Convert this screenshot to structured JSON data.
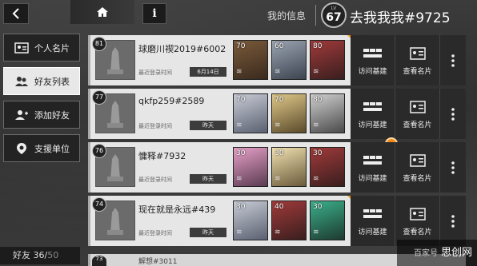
{
  "topbar": {
    "back_icon": "back-arrow-icon",
    "home_icon": "home-icon",
    "info_label": "i",
    "my_info_label": "我的信息",
    "level_small": "LV",
    "level": "67",
    "my_name": "去我我我#9725"
  },
  "menu": [
    {
      "label": "个人名片",
      "icon": "id-card-icon",
      "active": false
    },
    {
      "label": "好友列表",
      "icon": "friends-icon",
      "active": true
    },
    {
      "label": "添加好友",
      "icon": "add-friend-icon",
      "active": false
    },
    {
      "label": "支援单位",
      "icon": "support-unit-icon",
      "active": false
    }
  ],
  "friends_count": {
    "label": "好友",
    "current": "36",
    "sep": "/",
    "cap": "50"
  },
  "friends": [
    {
      "level": "81",
      "name": "球磨川禊2019#6002",
      "login_label": "最近登录时间",
      "login": "6月14日",
      "ops": [
        {
          "lv": "70"
        },
        {
          "lv": "60"
        },
        {
          "lv": "80"
        }
      ]
    },
    {
      "level": "77",
      "name": "qkfp259#2589",
      "login_label": "最近登录时间",
      "login": "昨天",
      "ops": [
        {
          "lv": "70"
        },
        {
          "lv": "70"
        },
        {
          "lv": "80"
        }
      ]
    },
    {
      "level": "76",
      "name": "慵释#7932",
      "login_label": "最近登录时间",
      "login": "昨天",
      "ops": [
        {
          "lv": "30"
        },
        {
          "lv": "30"
        },
        {
          "lv": "30"
        }
      ]
    },
    {
      "level": "74",
      "name": "现在就是永远#439",
      "login_label": "最近登录时间",
      "login": "昨天",
      "ops": [
        {
          "lv": "30"
        },
        {
          "lv": "40"
        },
        {
          "lv": "30"
        }
      ]
    }
  ],
  "partial": {
    "level": "73",
    "name": "解想#3011"
  },
  "actions": {
    "visit": "访问基建",
    "view": "查看名片"
  },
  "watermark": {
    "small": "百家号",
    "brand": "思创网"
  },
  "colors": {
    "accent": "#f39a1d",
    "row_bg": "#e6e6e6",
    "action_bg": "#2a2a2a"
  }
}
